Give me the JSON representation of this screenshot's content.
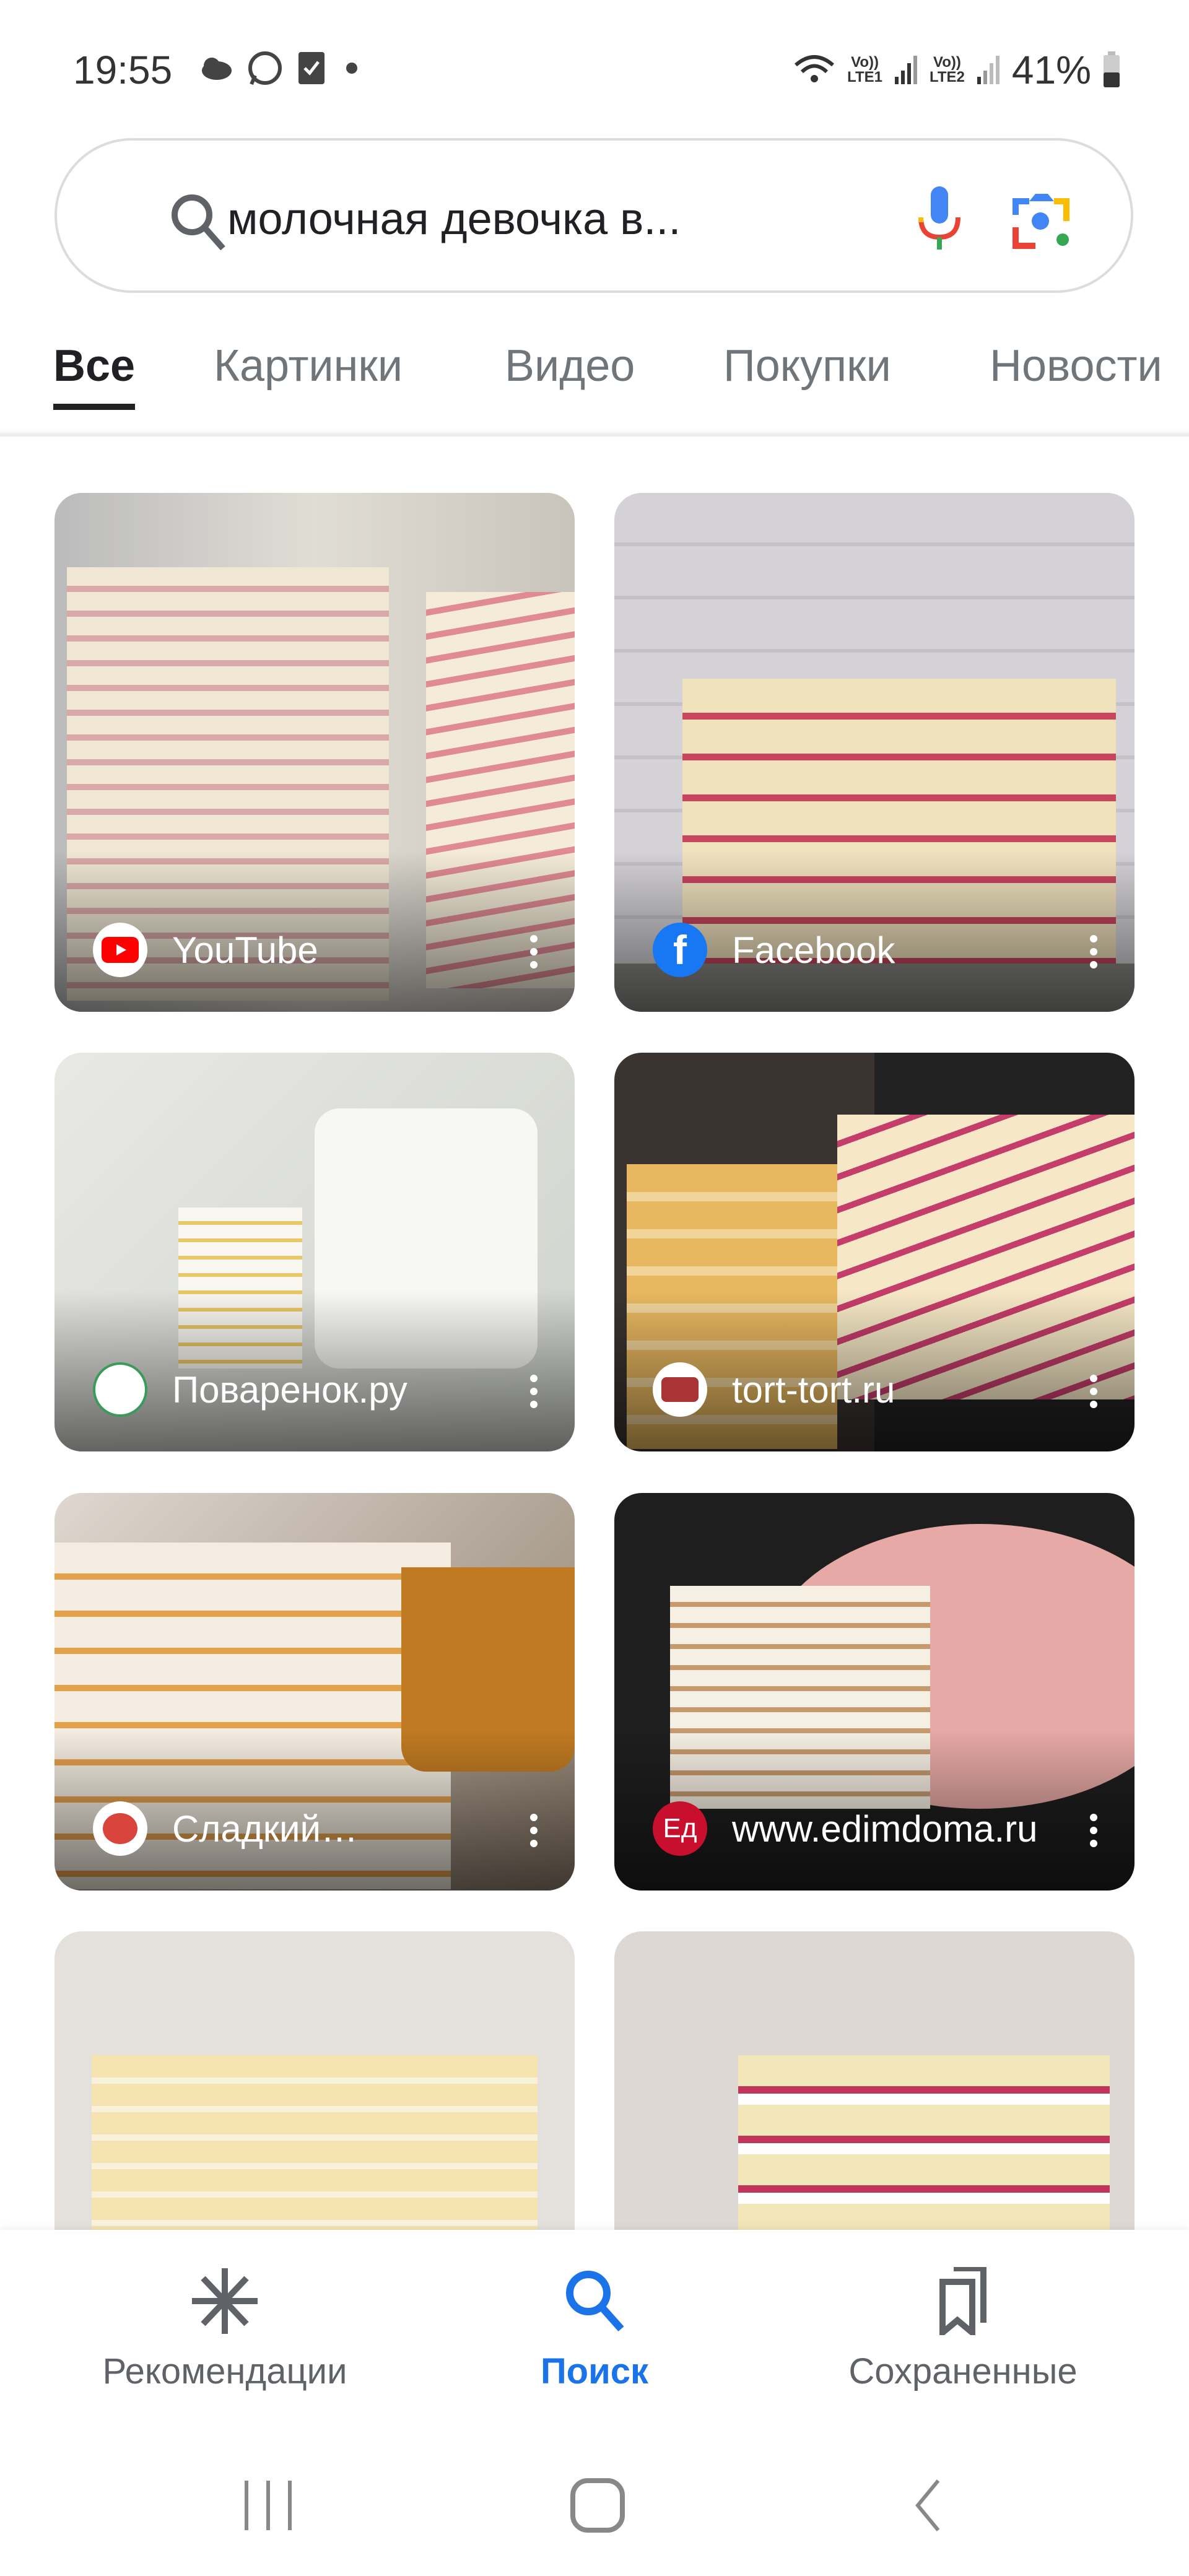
{
  "status_bar": {
    "time": "19:55",
    "battery": "41%",
    "sim1": "LTE1",
    "sim2": "LTE2",
    "volte": "Vo))"
  },
  "search": {
    "query": "молочная девочка в...",
    "mic_colors": [
      "#4285f4",
      "#ea4335",
      "#fbbc04",
      "#34a853"
    ]
  },
  "tabs": [
    {
      "label": "Все",
      "active": true
    },
    {
      "label": "Картинки"
    },
    {
      "label": "Видео"
    },
    {
      "label": "Покупки"
    },
    {
      "label": "Новости"
    }
  ],
  "results": [
    {
      "source": "YouTube",
      "favicon": "youtube-icon"
    },
    {
      "source": "Facebook",
      "favicon": "facebook-icon"
    },
    {
      "source": "Поваренок.ру",
      "favicon": "povarenok-icon"
    },
    {
      "source": "tort-tort.ru",
      "favicon": "tort-tort-icon"
    },
    {
      "source": "Сладкий…",
      "favicon": "cake-icon"
    },
    {
      "source": "www.edimdoma.ru",
      "favicon": "edimdoma-icon"
    },
    {
      "source": "",
      "favicon": ""
    },
    {
      "source": "",
      "favicon": ""
    }
  ],
  "bottom_nav": [
    {
      "label": "Рекомендации",
      "icon": "asterisk-icon"
    },
    {
      "label": "Поиск",
      "icon": "search-icon",
      "active": true
    },
    {
      "label": "Сохраненные",
      "icon": "bookmarks-icon"
    }
  ],
  "colors": {
    "accent": "#1a73e8",
    "text": "#202124",
    "muted": "#5f6368"
  }
}
